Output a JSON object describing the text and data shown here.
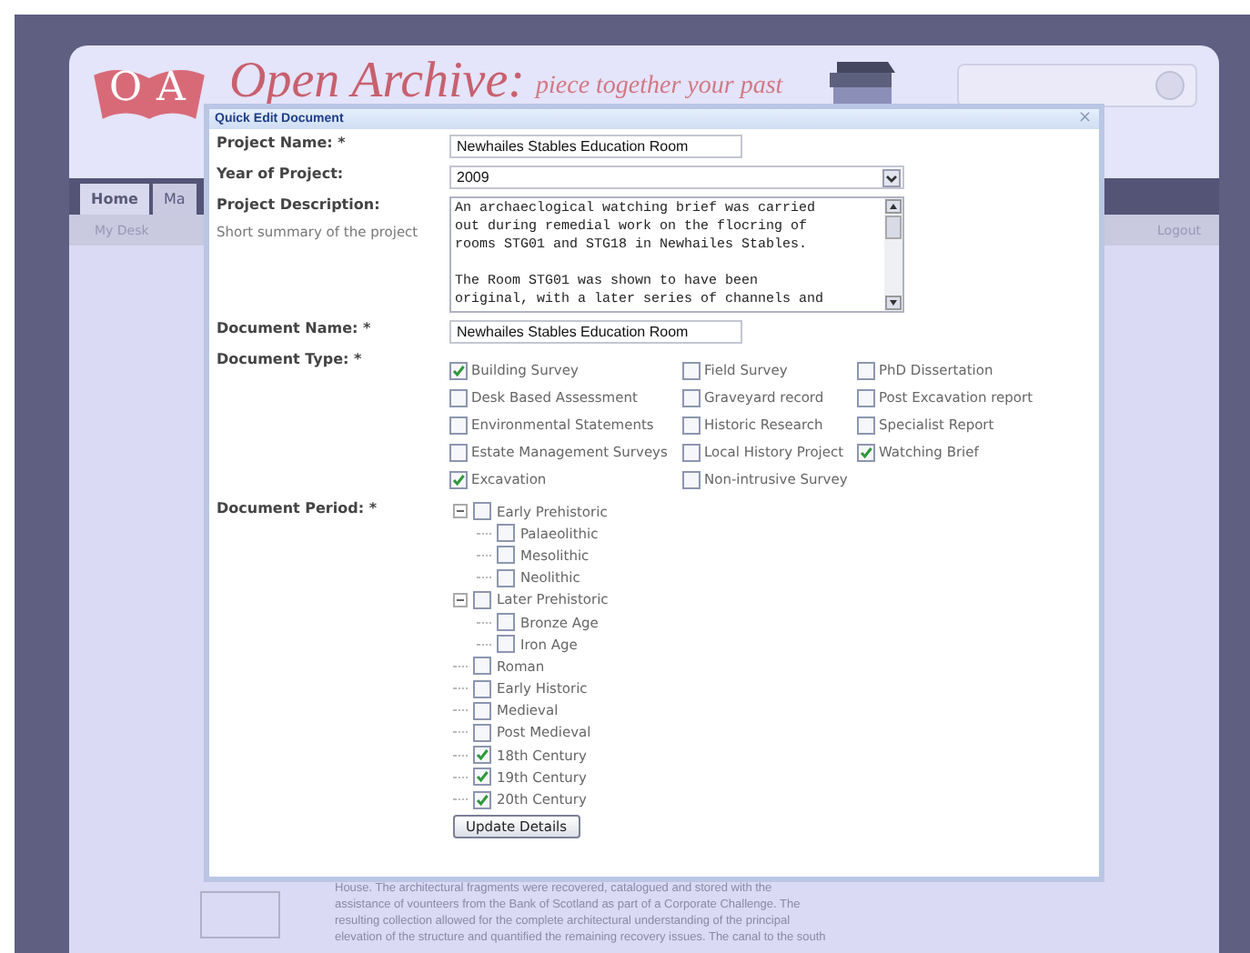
{
  "site": {
    "logo_letters": [
      "O",
      "A"
    ],
    "title": "Open Archive:",
    "tagline": "piece together your past",
    "nav": [
      {
        "label": "Home",
        "selected": true
      },
      {
        "label": "Ma",
        "selected": false
      }
    ],
    "subnav": "My Desk",
    "logout": "Logout",
    "background_text": [
      "House. The architectural fragments were recovered, catalogued and stored with the",
      "assistance of vounteers from the Bank of Scotland as part of a Corporate Challenge. The",
      "resulting collection allowed for the complete architectural understanding of the principal",
      "elevation of the structure and quantified the remaining recovery issues. The canal to the south"
    ]
  },
  "dialog": {
    "title": "Quick Edit Document",
    "close": "×",
    "project_name": {
      "label": "Project Name: *",
      "value": "Newhailes Stables Education Room"
    },
    "year": {
      "label": "Year of Project:",
      "value": "2009"
    },
    "description": {
      "label": "Project Description:",
      "hint": "Short summary of the project",
      "value": "An archaeclogical watching brief was carried\nout during remedial work on the flocring of\nrooms STG01 and STG18 in Newhailes Stables.\n\nThe Room STG01 was shown to have been\noriginal, with a later series of channels and"
    },
    "document_name": {
      "label": "Document Name: *",
      "value": "Newhailes Stables Education Room"
    },
    "document_type": {
      "label": "Document Type: *",
      "options": [
        {
          "label": "Building Survey",
          "checked": true
        },
        {
          "label": "Desk Based Assessment",
          "checked": false
        },
        {
          "label": "Environmental Statements",
          "checked": false
        },
        {
          "label": "Estate Management Surveys",
          "checked": false
        },
        {
          "label": "Excavation",
          "checked": true
        },
        {
          "label": "Field Survey",
          "checked": false
        },
        {
          "label": "Graveyard record",
          "checked": false
        },
        {
          "label": "Historic Research",
          "checked": false
        },
        {
          "label": "Local History Project",
          "checked": false
        },
        {
          "label": "Non-intrusive Survey",
          "checked": false
        },
        {
          "label": "PhD Dissertation",
          "checked": false
        },
        {
          "label": "Post Excavation report",
          "checked": false
        },
        {
          "label": "Specialist Report",
          "checked": false
        },
        {
          "label": "Watching Brief",
          "checked": true
        }
      ]
    },
    "document_period": {
      "label": "Document Period: *",
      "items": [
        {
          "label": "Early Prehistoric",
          "checked": false,
          "expanded": true,
          "children": [
            {
              "label": "Palaeolithic",
              "checked": false
            },
            {
              "label": "Mesolithic",
              "checked": false
            },
            {
              "label": "Neolithic",
              "checked": false
            }
          ]
        },
        {
          "label": "Later Prehistoric",
          "checked": false,
          "expanded": true,
          "children": [
            {
              "label": "Bronze Age",
              "checked": false
            },
            {
              "label": "Iron Age",
              "checked": false
            }
          ]
        },
        {
          "label": "Roman",
          "checked": false
        },
        {
          "label": "Early Historic",
          "checked": false
        },
        {
          "label": "Medieval",
          "checked": false
        },
        {
          "label": "Post Medieval",
          "checked": false
        },
        {
          "label": "18th Century",
          "checked": true
        },
        {
          "label": "19th Century",
          "checked": true
        },
        {
          "label": "20th Century",
          "checked": true
        }
      ]
    },
    "submit": "Update Details"
  }
}
